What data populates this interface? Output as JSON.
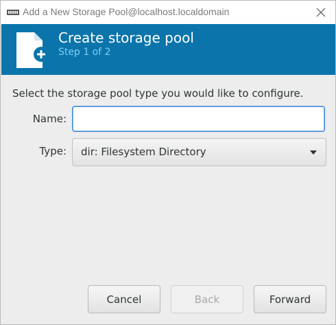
{
  "window": {
    "title": "Add a New Storage Pool@localhost.localdomain"
  },
  "banner": {
    "title": "Create storage pool",
    "step": "Step 1 of 2"
  },
  "form": {
    "instructions": "Select the storage pool type you would like to configure.",
    "name_label": "Name:",
    "name_value": "",
    "type_label": "Type:",
    "type_selected": "dir: Filesystem Directory"
  },
  "buttons": {
    "cancel": "Cancel",
    "back": "Back",
    "forward": "Forward"
  },
  "colors": {
    "banner": "#0b74ab",
    "step_text": "#7fd0f5",
    "focus": "#3c86d4"
  },
  "icons": {
    "app": "virt-manager-icon",
    "close": "close-icon",
    "banner": "new-document-icon",
    "dropdown": "dropdown-arrow-icon"
  }
}
